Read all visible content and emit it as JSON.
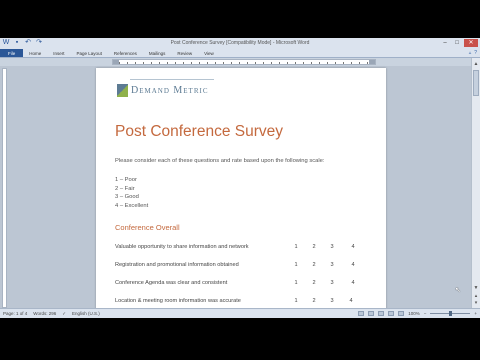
{
  "window": {
    "title": "Post Conference Survey [Compatibility Mode] - Microsoft Word",
    "controls": [
      "–",
      "□",
      "✕"
    ]
  },
  "ribbon": {
    "tabs": [
      "File",
      "Home",
      "Insert",
      "Page Layout",
      "References",
      "Mailings",
      "Review",
      "View"
    ],
    "help_icons": [
      "▵",
      "?"
    ]
  },
  "document": {
    "logo_text": "Demand Metric",
    "title": "Post Conference Survey",
    "intro": "Please consider each of these questions and rate based upon the following scale:",
    "scale": [
      "1 – Poor",
      "2 – Fair",
      "3 – Good",
      "4 – Excellent"
    ],
    "section_heading": "Conference Overall",
    "questions": [
      {
        "text": "Valuable opportunity to share information and network",
        "ratings": [
          "1",
          "2",
          "3",
          "4"
        ]
      },
      {
        "text": "Registration and promotional information obtained",
        "ratings": [
          "1",
          "2",
          "3",
          "4"
        ]
      },
      {
        "text": "Conference Agenda was clear and consistent",
        "ratings": [
          "1",
          "2",
          "3",
          "4"
        ]
      },
      {
        "text": "Location & meeting room information was accurate",
        "ratings": [
          "1",
          "2",
          "3",
          "4"
        ]
      }
    ]
  },
  "statusbar": {
    "page": "Page: 1 of 4",
    "words": "Words: 296",
    "language": "English (U.S.)",
    "zoom": "100%"
  },
  "colors": {
    "accent_title": "#c4693e",
    "file_tab": "#2b5797",
    "logo": "#5d7b93"
  }
}
